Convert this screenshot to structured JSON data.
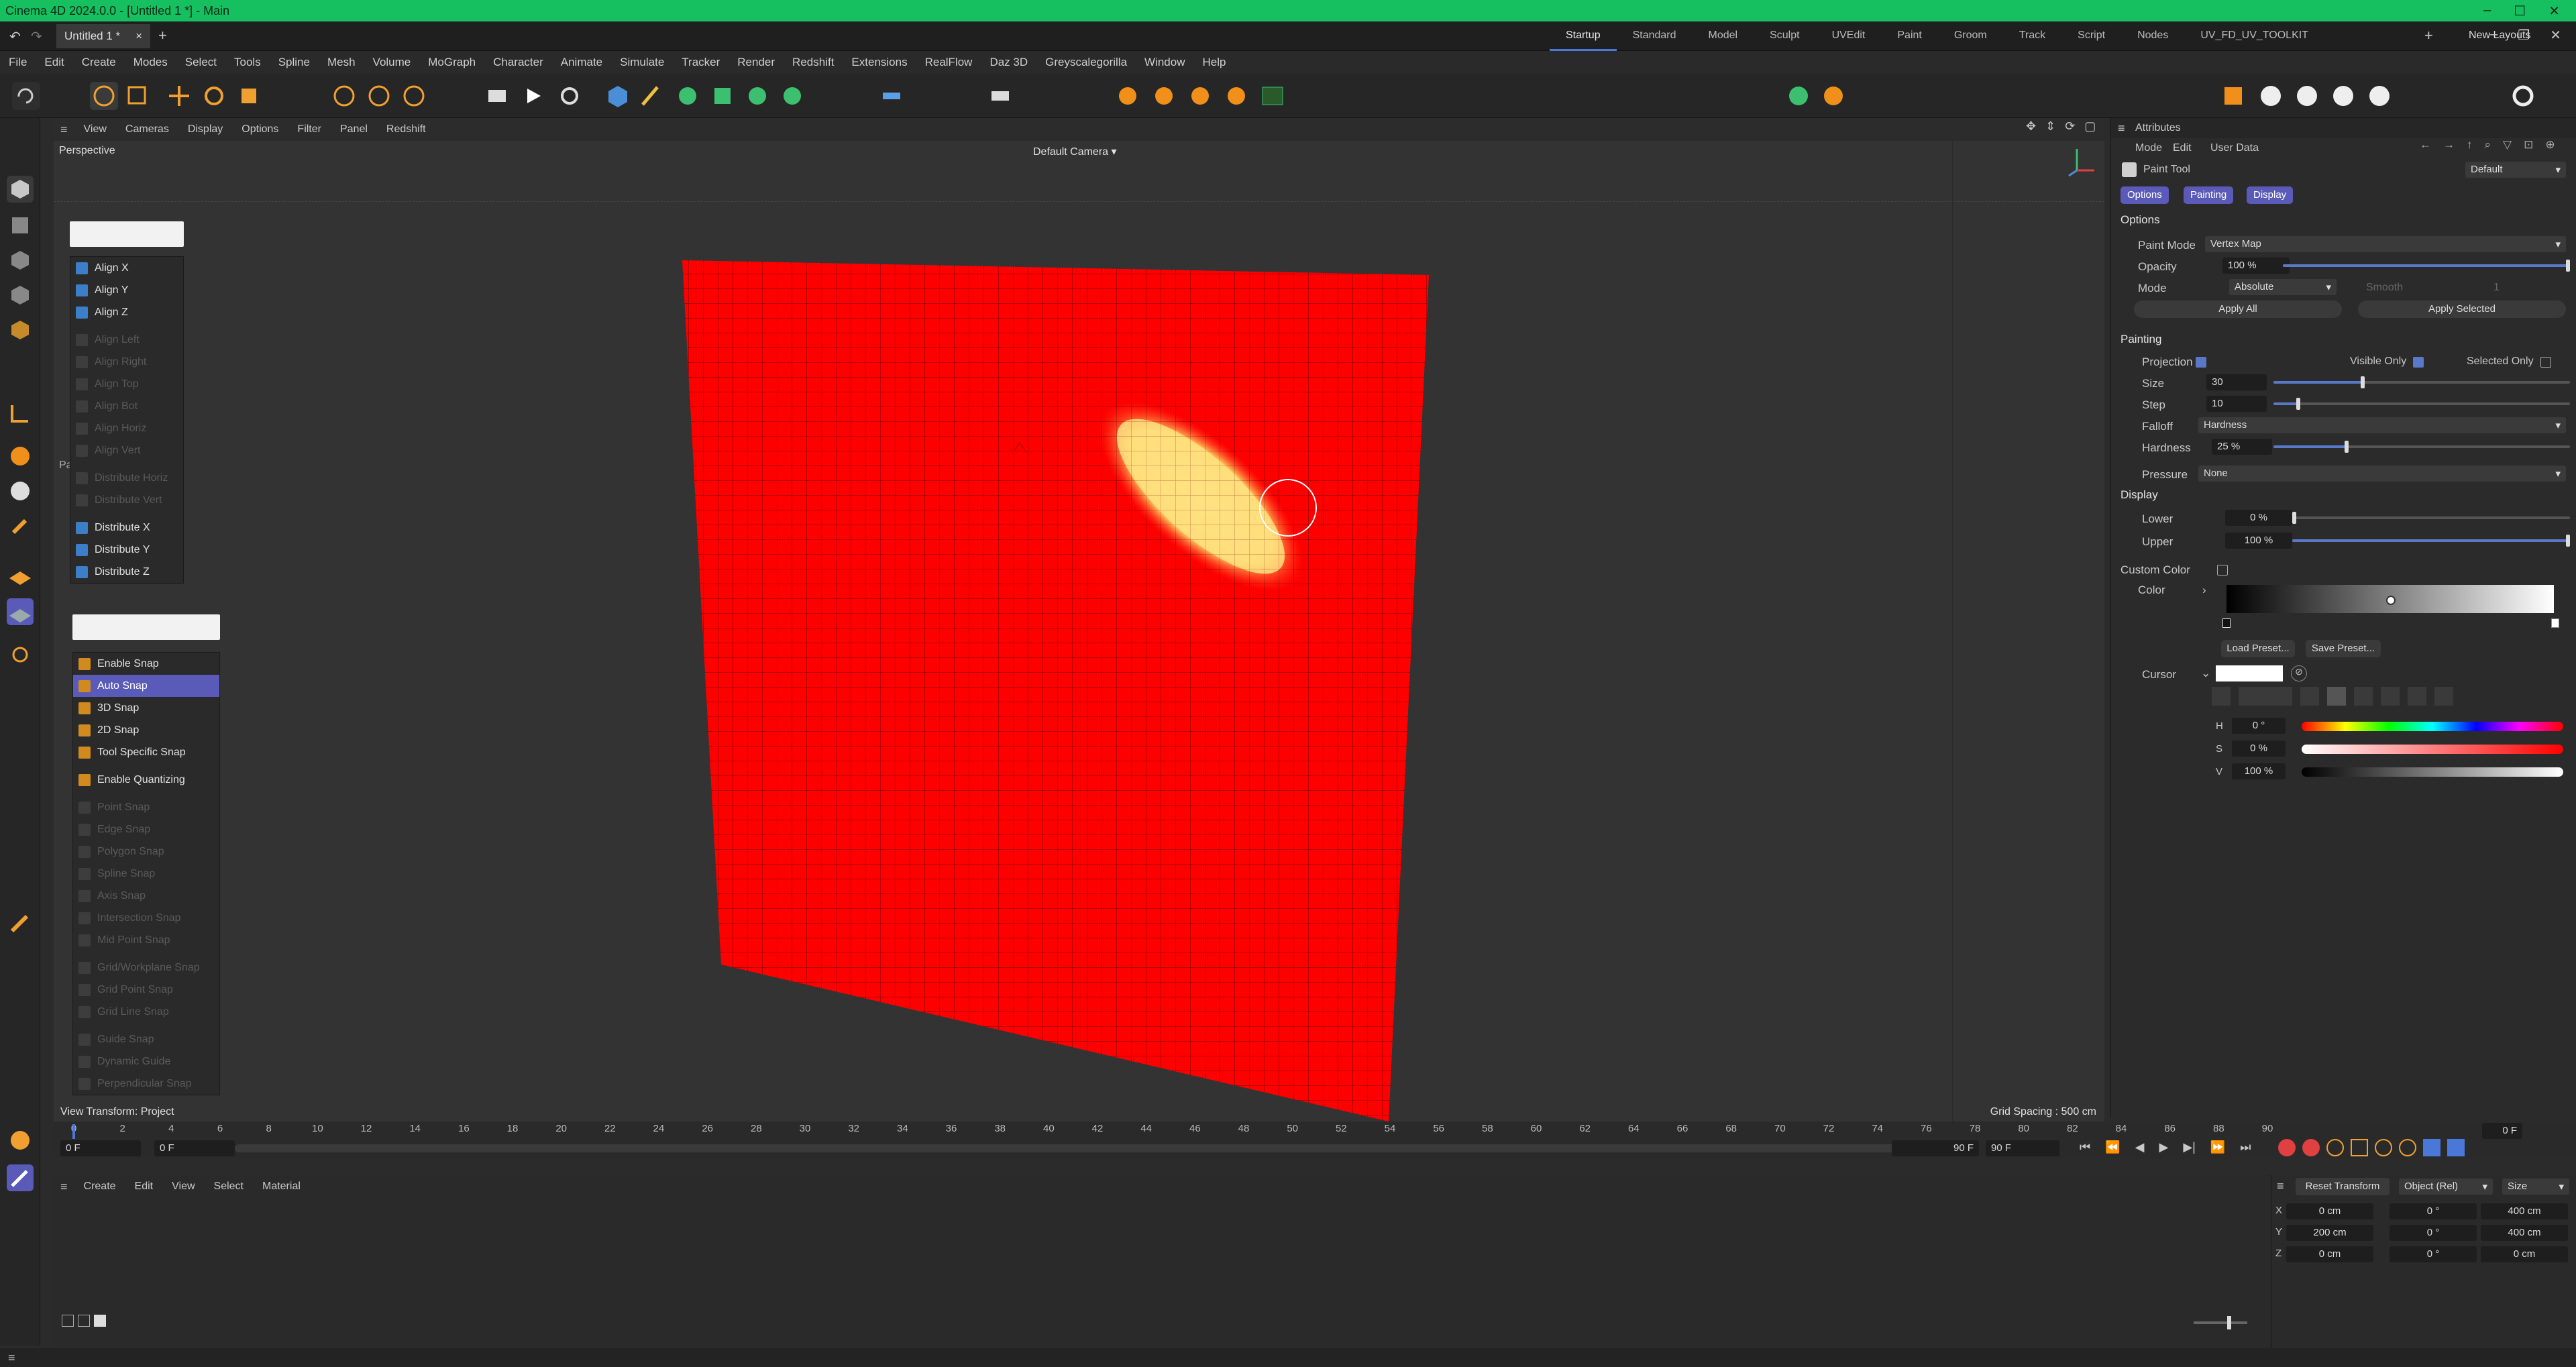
{
  "app": {
    "title": "Cinema 4D 2024.0.0 - [Untitled 1 *] - Main"
  },
  "tabs": {
    "doc": "Untitled 1 *",
    "close": "×",
    "plus": "+"
  },
  "layouts": [
    "Startup",
    "Standard",
    "Model",
    "Sculpt",
    "UVEdit",
    "Paint",
    "Groom",
    "Track",
    "Script",
    "Nodes",
    "UV_FD_UV_TOOLKIT"
  ],
  "layouts_active": "Startup",
  "new_layouts": "New Layouts",
  "menu": [
    "File",
    "Edit",
    "Create",
    "Modes",
    "Select",
    "Tools",
    "Spline",
    "Mesh",
    "Volume",
    "MoGraph",
    "Character",
    "Animate",
    "Simulate",
    "Tracker",
    "Render",
    "Redshift",
    "Extensions",
    "RealFlow",
    "Daz 3D",
    "Greyscalegorilla",
    "Window",
    "Help"
  ],
  "viewport": {
    "menu": [
      "View",
      "Cameras",
      "Display",
      "Options",
      "Filter",
      "Panel",
      "Redshift"
    ],
    "label": "Perspective",
    "camera": "Default Camera",
    "grid_spacing": "Grid Spacing : 500 cm",
    "view_transform": "View Transform: Project",
    "cut_label": "Pa"
  },
  "align_popup": {
    "items": [
      {
        "label": "Align X",
        "enabled": true
      },
      {
        "label": "Align Y",
        "enabled": true
      },
      {
        "label": "Align Z",
        "enabled": true
      },
      {
        "label": "Align Left",
        "enabled": false
      },
      {
        "label": "Align Right",
        "enabled": false
      },
      {
        "label": "Align Top",
        "enabled": false
      },
      {
        "label": "Align Bot",
        "enabled": false
      },
      {
        "label": "Align Horiz",
        "enabled": false
      },
      {
        "label": "Align Vert",
        "enabled": false
      },
      {
        "label": "Distribute Horiz",
        "enabled": false
      },
      {
        "label": "Distribute Vert",
        "enabled": false
      },
      {
        "label": "Distribute X",
        "enabled": true
      },
      {
        "label": "Distribute Y",
        "enabled": true
      },
      {
        "label": "Distribute Z",
        "enabled": true
      }
    ]
  },
  "snap_popup": {
    "items": [
      {
        "label": "Enable Snap",
        "enabled": true,
        "selected": false
      },
      {
        "label": "Auto Snap",
        "enabled": true,
        "selected": true
      },
      {
        "label": "3D Snap",
        "enabled": true,
        "selected": false
      },
      {
        "label": "2D Snap",
        "enabled": true,
        "selected": false
      },
      {
        "label": "Tool Specific Snap",
        "enabled": true,
        "selected": false
      },
      {
        "label": "Enable Quantizing",
        "enabled": true,
        "selected": false
      },
      {
        "label": "Point Snap",
        "enabled": false,
        "selected": false
      },
      {
        "label": "Edge Snap",
        "enabled": false,
        "selected": false
      },
      {
        "label": "Polygon Snap",
        "enabled": false,
        "selected": false
      },
      {
        "label": "Spline Snap",
        "enabled": false,
        "selected": false
      },
      {
        "label": "Axis Snap",
        "enabled": false,
        "selected": false
      },
      {
        "label": "Intersection Snap",
        "enabled": false,
        "selected": false
      },
      {
        "label": "Mid Point Snap",
        "enabled": false,
        "selected": false
      },
      {
        "label": "Grid/Workplane Snap",
        "enabled": false,
        "selected": false
      },
      {
        "label": "Grid Point Snap",
        "enabled": false,
        "selected": false
      },
      {
        "label": "Grid Line Snap",
        "enabled": false,
        "selected": false
      },
      {
        "label": "Guide Snap",
        "enabled": false,
        "selected": false
      },
      {
        "label": "Dynamic Guide",
        "enabled": false,
        "selected": false
      },
      {
        "label": "Perpendicular Snap",
        "enabled": false,
        "selected": false
      }
    ]
  },
  "timeline": {
    "ticks": [
      "0",
      "2",
      "4",
      "6",
      "8",
      "10",
      "12",
      "14",
      "16",
      "18",
      "20",
      "22",
      "24",
      "26",
      "28",
      "30",
      "32",
      "34",
      "36",
      "38",
      "40",
      "42",
      "44",
      "46",
      "48",
      "50",
      "52",
      "54",
      "56",
      "58",
      "60",
      "62",
      "64",
      "66",
      "68",
      "70",
      "72",
      "74",
      "76",
      "78",
      "80",
      "82",
      "84",
      "86",
      "88",
      "90"
    ],
    "start": "0 F",
    "current": "0 F",
    "end": "90 F",
    "end2": "90 F",
    "frame_display": "0 F"
  },
  "material_menu": [
    "Create",
    "Edit",
    "View",
    "Select",
    "Material"
  ],
  "coordinates": {
    "reset": "Reset Transform",
    "mode": "Object (Rel)",
    "size_mode": "Size",
    "rows": [
      {
        "axis": "X",
        "pos": "0 cm",
        "rot": "0 °",
        "size": "400 cm"
      },
      {
        "axis": "Y",
        "pos": "200 cm",
        "rot": "0 °",
        "size": "400 cm"
      },
      {
        "axis": "Z",
        "pos": "0 cm",
        "rot": "0 °",
        "size": "0 cm"
      }
    ]
  },
  "attributes": {
    "title": "Attributes",
    "menu": [
      "Mode",
      "Edit",
      "User Data"
    ],
    "tool": "Paint Tool",
    "preset": "Default",
    "tabs": [
      "Options",
      "Painting",
      "Display"
    ],
    "options": {
      "header": "Options",
      "paint_mode_label": "Paint Mode",
      "paint_mode": "Vertex Map",
      "opacity_label": "Opacity",
      "opacity": "100 %",
      "mode_label": "Mode",
      "mode": "Absolute",
      "smooth_label": "Smooth",
      "smooth": "1",
      "apply_all": "Apply All",
      "apply_selected": "Apply Selected"
    },
    "painting": {
      "header": "Painting",
      "projection_label": "Projection",
      "visible_only_label": "Visible Only",
      "selected_only_label": "Selected Only",
      "size_label": "Size",
      "size": "30",
      "step_label": "Step",
      "step": "10",
      "falloff_label": "Falloff",
      "falloff": "Hardness",
      "hardness_label": "Hardness",
      "hardness": "25 %",
      "pressure_label": "Pressure",
      "pressure": "None"
    },
    "display": {
      "header": "Display",
      "lower_label": "Lower",
      "lower": "0 %",
      "upper_label": "Upper",
      "upper": "100 %",
      "custom_color_label": "Custom Color",
      "color_label": "Color",
      "load_preset": "Load Preset...",
      "save_preset": "Save Preset...",
      "cursor_label": "Cursor",
      "h_label": "H",
      "h": "0 °",
      "s_label": "S",
      "s": "0 %",
      "v_label": "V",
      "v": "100 %"
    }
  },
  "colors": {
    "accent": "#5a5ab8",
    "title_bar": "#16c060",
    "plane": "#ff0000",
    "paint": "#ffe070"
  }
}
